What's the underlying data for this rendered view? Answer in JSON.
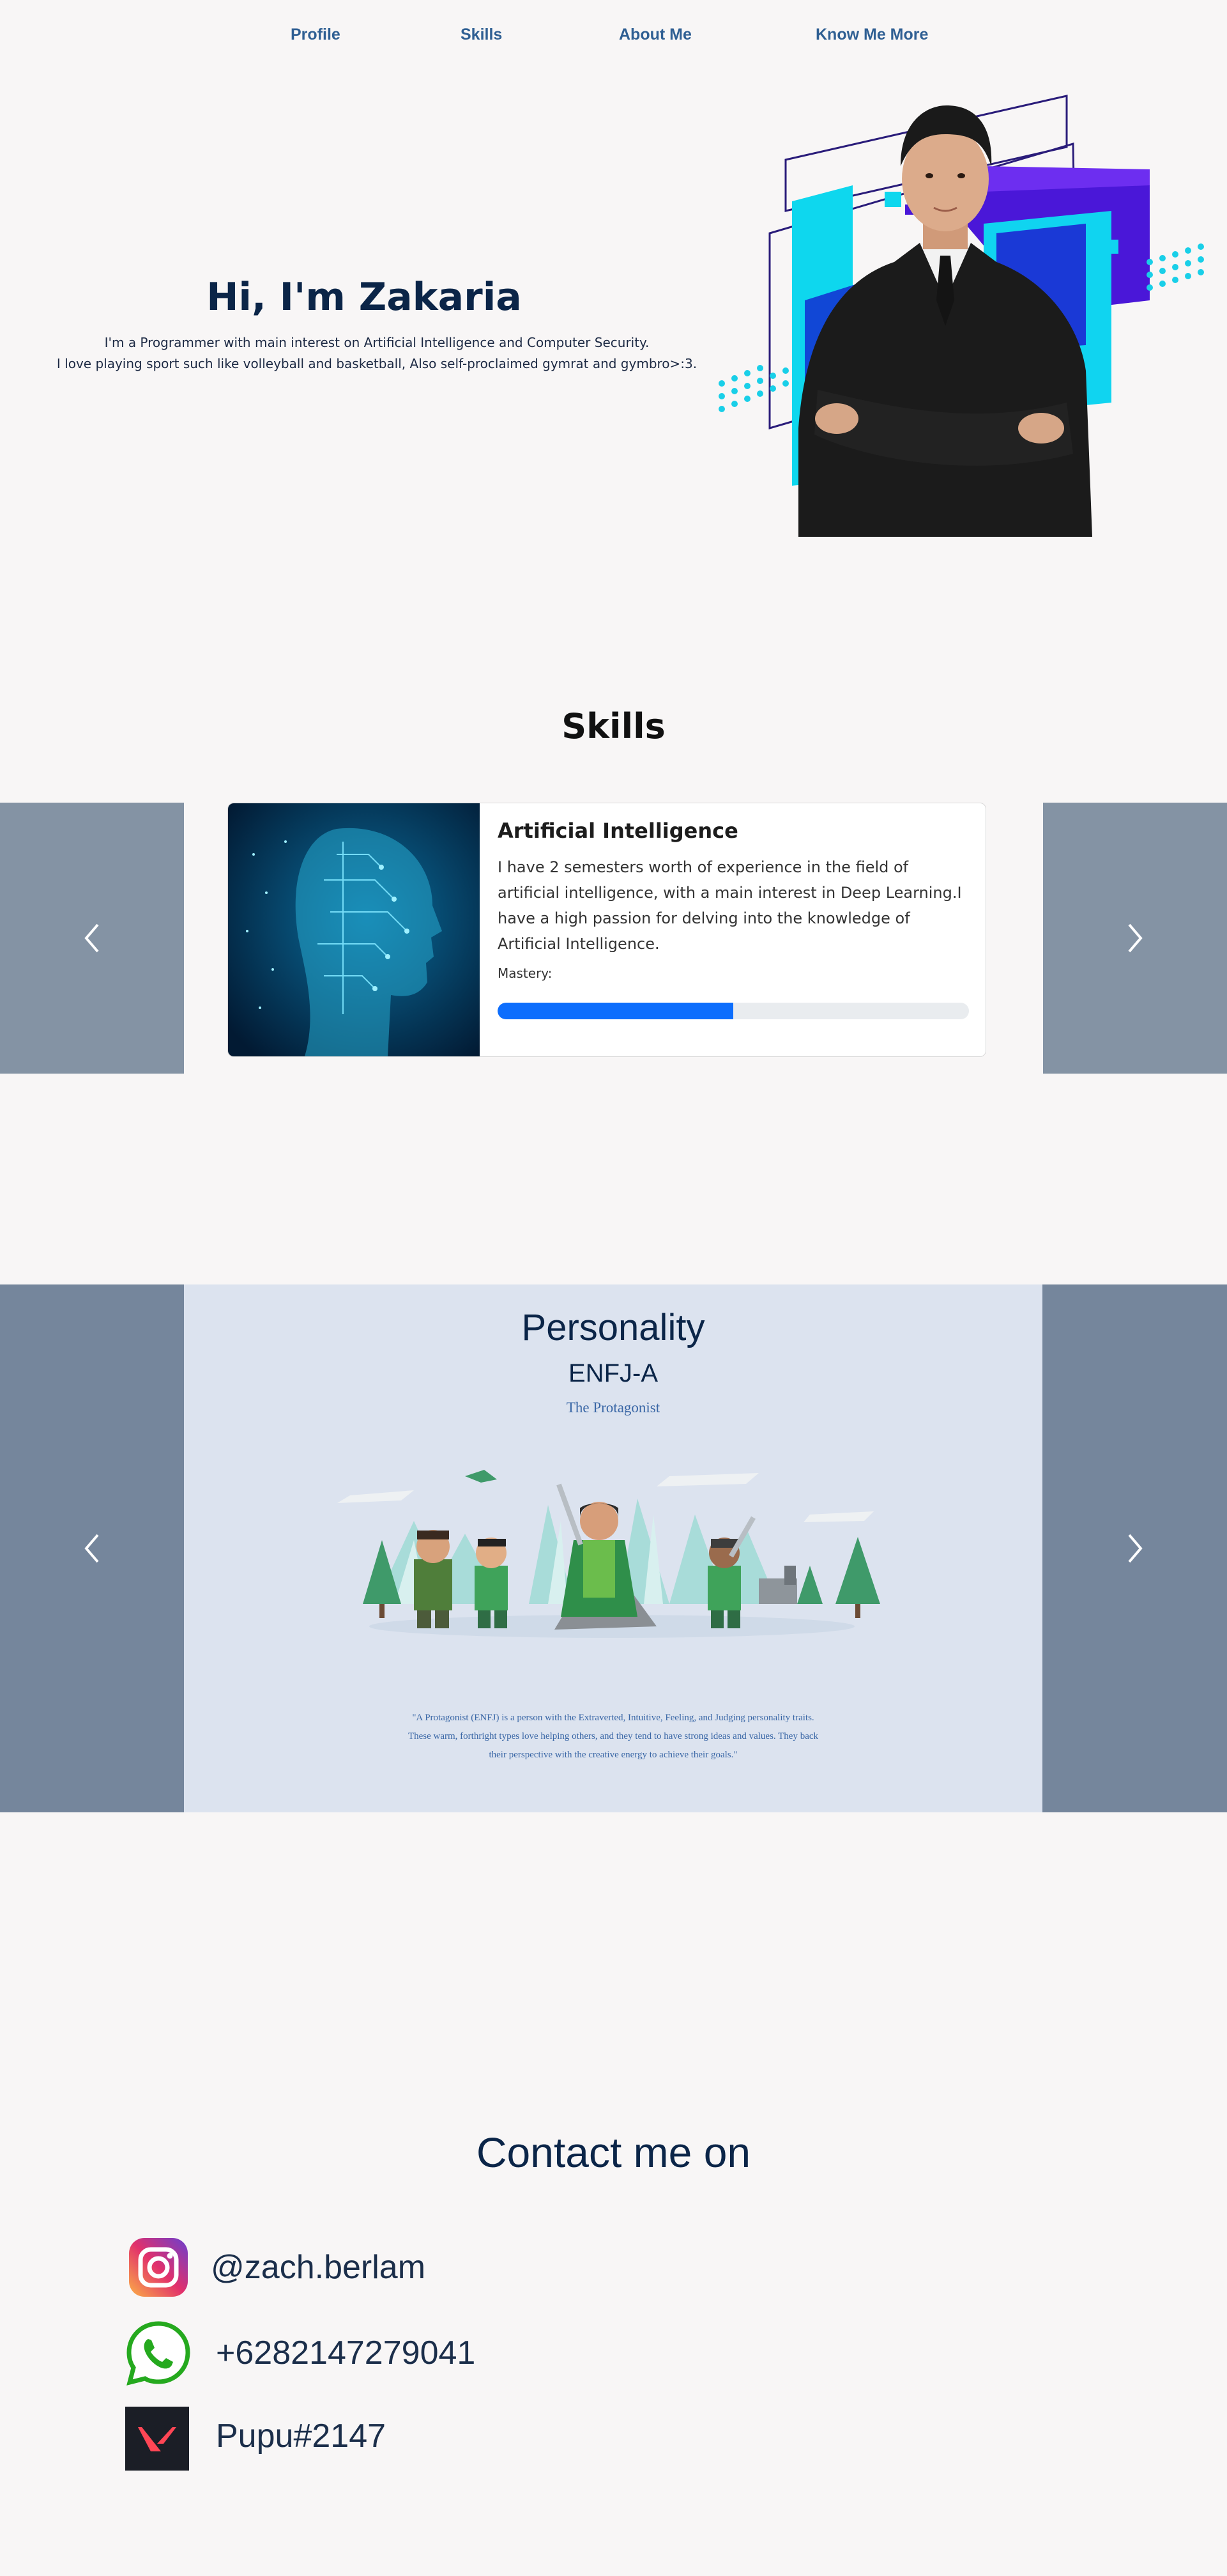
{
  "nav": {
    "items": [
      "Profile",
      "Skills",
      "About Me",
      "Know Me More"
    ]
  },
  "hero": {
    "title": "Hi, I'm Zakaria",
    "line1": "I'm a Programmer with main interest on Artificial Intelligence and Computer Security.",
    "line2": "I love playing sport such like volleyball and basketball, Also self-proclaimed gymrat and gymbro>:3."
  },
  "skills": {
    "title": "Skills",
    "card": {
      "title": "Artificial Intelligence",
      "text": "I have 2 semesters worth of experience in the field of artificial intelligence, with a main interest in Deep Learning.I have a high passion for delving into the knowledge of Artificial Intelligence.",
      "mastery_label": "Mastery:",
      "mastery_fraction": 0.5
    }
  },
  "personality": {
    "title": "Personality",
    "type": "ENFJ-A",
    "subtitle": "The Protagonist",
    "quote": "\"A Protagonist (ENFJ) is a person with the Extraverted, Intuitive, Feeling, and Judging personality traits. These warm, forthright types love helping others, and they tend to have strong ideas and values. They back their perspective with the creative energy to achieve their goals.\""
  },
  "contact": {
    "title": "Contact me on",
    "items": [
      {
        "icon": "instagram-icon",
        "text": "@zach.berlam"
      },
      {
        "icon": "whatsapp-icon",
        "text": "+6282147279041"
      },
      {
        "icon": "valorant-icon",
        "text": "Pupu#2147"
      }
    ]
  },
  "colors": {
    "navy": "#0b2548",
    "link": "#2f5f93",
    "progress": "#0d6efd",
    "side_panel": "#8493a4",
    "personality_bg": "#dce3ef"
  }
}
